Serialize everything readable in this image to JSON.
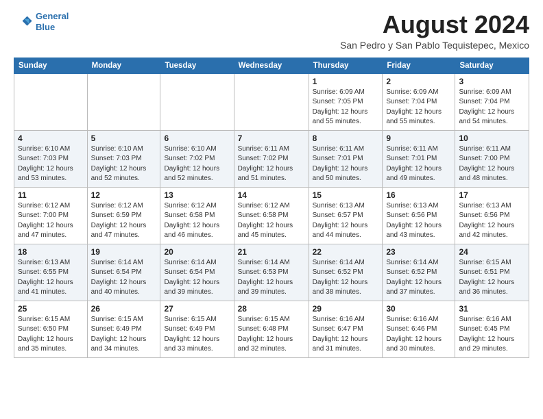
{
  "header": {
    "logo_line1": "General",
    "logo_line2": "Blue",
    "month_year": "August 2024",
    "location": "San Pedro y San Pablo Tequistepec, Mexico"
  },
  "days_of_week": [
    "Sunday",
    "Monday",
    "Tuesday",
    "Wednesday",
    "Thursday",
    "Friday",
    "Saturday"
  ],
  "weeks": [
    [
      {
        "day": "",
        "info": ""
      },
      {
        "day": "",
        "info": ""
      },
      {
        "day": "",
        "info": ""
      },
      {
        "day": "",
        "info": ""
      },
      {
        "day": "1",
        "info": "Sunrise: 6:09 AM\nSunset: 7:05 PM\nDaylight: 12 hours\nand 55 minutes."
      },
      {
        "day": "2",
        "info": "Sunrise: 6:09 AM\nSunset: 7:04 PM\nDaylight: 12 hours\nand 55 minutes."
      },
      {
        "day": "3",
        "info": "Sunrise: 6:09 AM\nSunset: 7:04 PM\nDaylight: 12 hours\nand 54 minutes."
      }
    ],
    [
      {
        "day": "4",
        "info": "Sunrise: 6:10 AM\nSunset: 7:03 PM\nDaylight: 12 hours\nand 53 minutes."
      },
      {
        "day": "5",
        "info": "Sunrise: 6:10 AM\nSunset: 7:03 PM\nDaylight: 12 hours\nand 52 minutes."
      },
      {
        "day": "6",
        "info": "Sunrise: 6:10 AM\nSunset: 7:02 PM\nDaylight: 12 hours\nand 52 minutes."
      },
      {
        "day": "7",
        "info": "Sunrise: 6:11 AM\nSunset: 7:02 PM\nDaylight: 12 hours\nand 51 minutes."
      },
      {
        "day": "8",
        "info": "Sunrise: 6:11 AM\nSunset: 7:01 PM\nDaylight: 12 hours\nand 50 minutes."
      },
      {
        "day": "9",
        "info": "Sunrise: 6:11 AM\nSunset: 7:01 PM\nDaylight: 12 hours\nand 49 minutes."
      },
      {
        "day": "10",
        "info": "Sunrise: 6:11 AM\nSunset: 7:00 PM\nDaylight: 12 hours\nand 48 minutes."
      }
    ],
    [
      {
        "day": "11",
        "info": "Sunrise: 6:12 AM\nSunset: 7:00 PM\nDaylight: 12 hours\nand 47 minutes."
      },
      {
        "day": "12",
        "info": "Sunrise: 6:12 AM\nSunset: 6:59 PM\nDaylight: 12 hours\nand 47 minutes."
      },
      {
        "day": "13",
        "info": "Sunrise: 6:12 AM\nSunset: 6:58 PM\nDaylight: 12 hours\nand 46 minutes."
      },
      {
        "day": "14",
        "info": "Sunrise: 6:12 AM\nSunset: 6:58 PM\nDaylight: 12 hours\nand 45 minutes."
      },
      {
        "day": "15",
        "info": "Sunrise: 6:13 AM\nSunset: 6:57 PM\nDaylight: 12 hours\nand 44 minutes."
      },
      {
        "day": "16",
        "info": "Sunrise: 6:13 AM\nSunset: 6:56 PM\nDaylight: 12 hours\nand 43 minutes."
      },
      {
        "day": "17",
        "info": "Sunrise: 6:13 AM\nSunset: 6:56 PM\nDaylight: 12 hours\nand 42 minutes."
      }
    ],
    [
      {
        "day": "18",
        "info": "Sunrise: 6:13 AM\nSunset: 6:55 PM\nDaylight: 12 hours\nand 41 minutes."
      },
      {
        "day": "19",
        "info": "Sunrise: 6:14 AM\nSunset: 6:54 PM\nDaylight: 12 hours\nand 40 minutes."
      },
      {
        "day": "20",
        "info": "Sunrise: 6:14 AM\nSunset: 6:54 PM\nDaylight: 12 hours\nand 39 minutes."
      },
      {
        "day": "21",
        "info": "Sunrise: 6:14 AM\nSunset: 6:53 PM\nDaylight: 12 hours\nand 39 minutes."
      },
      {
        "day": "22",
        "info": "Sunrise: 6:14 AM\nSunset: 6:52 PM\nDaylight: 12 hours\nand 38 minutes."
      },
      {
        "day": "23",
        "info": "Sunrise: 6:14 AM\nSunset: 6:52 PM\nDaylight: 12 hours\nand 37 minutes."
      },
      {
        "day": "24",
        "info": "Sunrise: 6:15 AM\nSunset: 6:51 PM\nDaylight: 12 hours\nand 36 minutes."
      }
    ],
    [
      {
        "day": "25",
        "info": "Sunrise: 6:15 AM\nSunset: 6:50 PM\nDaylight: 12 hours\nand 35 minutes."
      },
      {
        "day": "26",
        "info": "Sunrise: 6:15 AM\nSunset: 6:49 PM\nDaylight: 12 hours\nand 34 minutes."
      },
      {
        "day": "27",
        "info": "Sunrise: 6:15 AM\nSunset: 6:49 PM\nDaylight: 12 hours\nand 33 minutes."
      },
      {
        "day": "28",
        "info": "Sunrise: 6:15 AM\nSunset: 6:48 PM\nDaylight: 12 hours\nand 32 minutes."
      },
      {
        "day": "29",
        "info": "Sunrise: 6:16 AM\nSunset: 6:47 PM\nDaylight: 12 hours\nand 31 minutes."
      },
      {
        "day": "30",
        "info": "Sunrise: 6:16 AM\nSunset: 6:46 PM\nDaylight: 12 hours\nand 30 minutes."
      },
      {
        "day": "31",
        "info": "Sunrise: 6:16 AM\nSunset: 6:45 PM\nDaylight: 12 hours\nand 29 minutes."
      }
    ]
  ]
}
